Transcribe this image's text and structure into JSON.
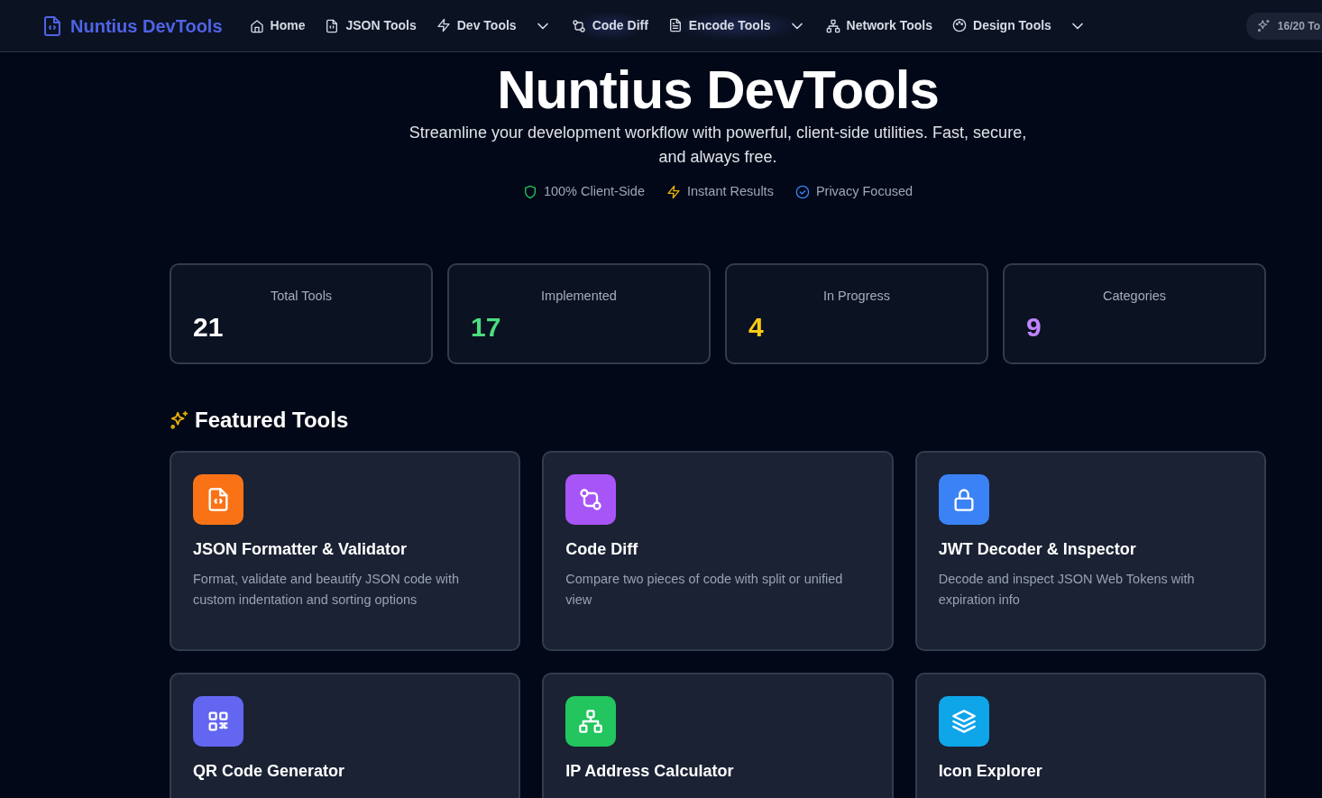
{
  "navbar": {
    "brand": "Nuntius DevTools",
    "items": [
      {
        "label": "Home",
        "dropdown": false,
        "glow": false
      },
      {
        "label": "JSON Tools",
        "dropdown": false,
        "glow": false
      },
      {
        "label": "Dev Tools",
        "dropdown": true,
        "glow": false
      },
      {
        "label": "Code Diff",
        "dropdown": false,
        "glow": true
      },
      {
        "label": "Encode Tools",
        "dropdown": true,
        "glow": true
      },
      {
        "label": "Network Tools",
        "dropdown": false,
        "glow": false
      },
      {
        "label": "Design Tools",
        "dropdown": true,
        "glow": false
      }
    ],
    "progress_pill": "16/20 To"
  },
  "hero": {
    "title": "Nuntius DevTools",
    "subtitle": "Streamline your development workflow with powerful, client-side utilities. Fast, secure, and always free.",
    "features": [
      {
        "label": "100% Client-Side",
        "color": "#22c55e"
      },
      {
        "label": "Instant Results",
        "color": "#eab308"
      },
      {
        "label": "Privacy Focused",
        "color": "#3b82f6"
      }
    ]
  },
  "stats": [
    {
      "label": "Total Tools",
      "value": "21",
      "color": "#ffffff"
    },
    {
      "label": "Implemented",
      "value": "17",
      "color": "#4ade80"
    },
    {
      "label": "In Progress",
      "value": "4",
      "color": "#facc15"
    },
    {
      "label": "Categories",
      "value": "9",
      "color": "#c084fc"
    }
  ],
  "featured": {
    "heading": "Featured Tools",
    "tools": [
      {
        "title": "JSON Formatter & Validator",
        "description": "Format, validate and beautify JSON code with custom indentation and sorting options",
        "color": "#f97316"
      },
      {
        "title": "Code Diff",
        "description": "Compare two pieces of code with split or unified view",
        "color": "#a855f7"
      },
      {
        "title": "JWT Decoder & Inspector",
        "description": "Decode and inspect JSON Web Tokens with expiration info",
        "color": "#3b82f6"
      },
      {
        "title": "QR Code Generator",
        "color": "#6366f1"
      },
      {
        "title": "IP Address Calculator",
        "color": "#22c55e"
      },
      {
        "title": "Icon Explorer",
        "color": "#0ea5e9"
      }
    ]
  }
}
